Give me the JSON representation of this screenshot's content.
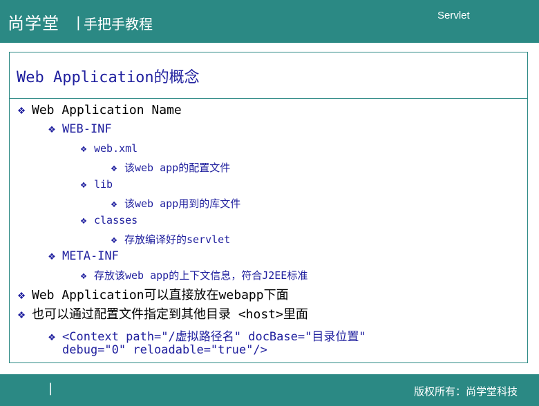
{
  "header": {
    "brand": "尚学堂",
    "separator": "|",
    "subtitle": "手把手教程",
    "course": "Servlet"
  },
  "slide": {
    "title": "Web Application的概念",
    "bullet_glyph": "❖",
    "items": [
      {
        "text": "Web Application Name"
      },
      {
        "text": "WEB-INF"
      },
      {
        "text": "web.xml"
      },
      {
        "text": "该web app的配置文件"
      },
      {
        "text": "lib"
      },
      {
        "text": "该web app用到的库文件"
      },
      {
        "text": "classes"
      },
      {
        "text": "存放编译好的servlet"
      },
      {
        "text": "META-INF"
      },
      {
        "text": "存放该web app的上下文信息，符合J2EE标准"
      },
      {
        "text": "Web Application可以直接放在webapp下面"
      },
      {
        "text": "也可以通过配置文件指定到其他目录 <host>里面"
      },
      {
        "text": "<Context path=\"/虚拟路径名\" docBase=\"目录位置\""
      },
      {
        "text": "debug=\"0\" reloadable=\"true\"/>"
      }
    ]
  },
  "footer": {
    "separator": "|",
    "copyright": "版权所有：尚学堂科技"
  },
  "colors": {
    "bar": "#2b8984",
    "accent_text": "#1f1f9e"
  }
}
